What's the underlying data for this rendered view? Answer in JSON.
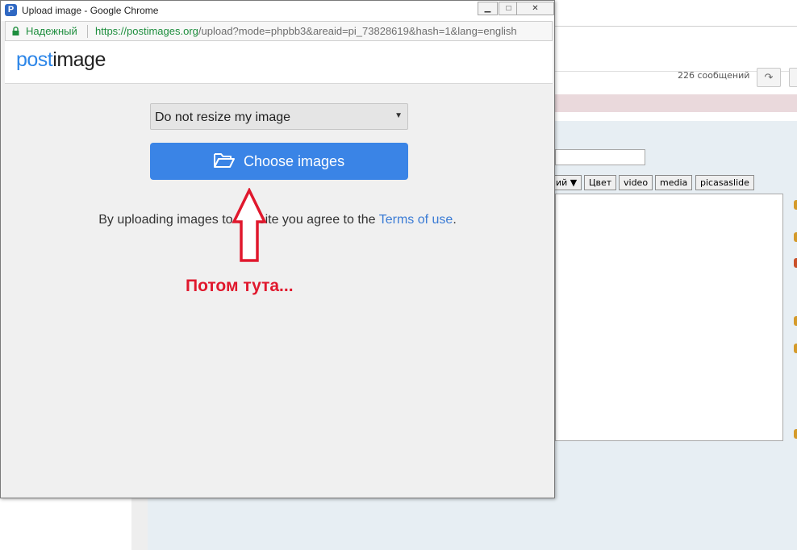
{
  "background": {
    "message_count": "226 сообщений",
    "toolbar_buttons": [
      "Цвет",
      "video",
      "media",
      "picasaslide"
    ],
    "partial_select_label": "ий"
  },
  "popup": {
    "window_title": "Upload image - Google Chrome",
    "secure_label": "Надежный",
    "url_scheme_host": "https://postimages.org",
    "url_path": "/upload?mode=phpbb3&areaid=pi_73828619&hash=1&lang=english",
    "logo_part1": "post",
    "logo_part2": "image",
    "resize_selected": "Do not resize my image",
    "choose_button": "Choose images",
    "terms_text": "By uploading images to our site you agree to the",
    "terms_link": "Terms of use",
    "terms_end": "."
  },
  "annotation": {
    "text": "Потом тута...",
    "color": "#e0182d"
  },
  "colors": {
    "brand_blue": "#3a84e6",
    "secure_green": "#1e8e3e"
  }
}
